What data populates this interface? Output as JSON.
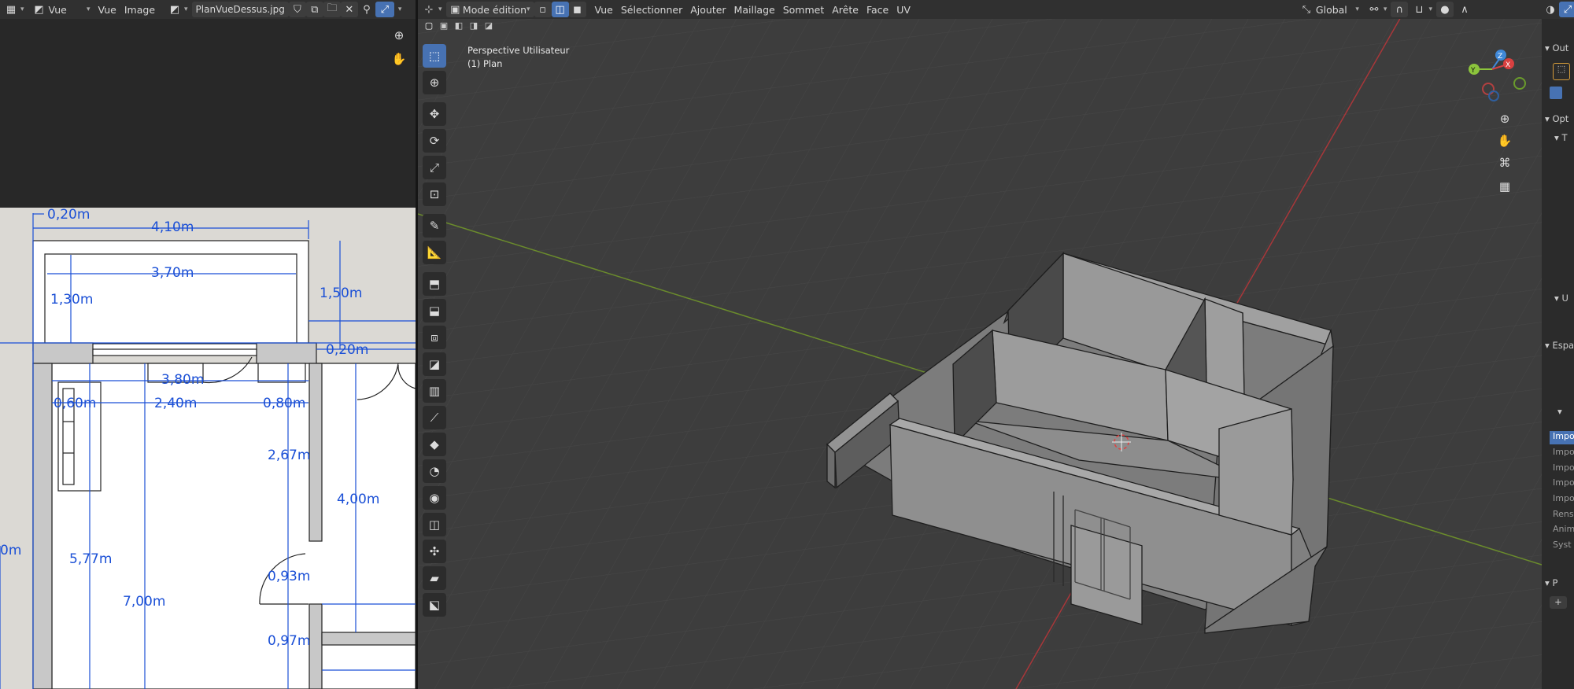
{
  "image_editor": {
    "header": {
      "view_menu": "Vue",
      "menus": [
        "Vue",
        "Image"
      ],
      "image_name": "PlanVueDessus.jpg"
    },
    "dimensions": [
      "0,20m",
      "4,10m",
      "3,70m",
      "1,30m",
      "1,50m",
      "0,20m",
      "3,80m",
      "0,60m",
      "2,40m",
      "0,80m",
      "2,67m",
      "4,00m",
      "5,77m",
      "7,00m",
      "0,93m",
      "0,97m",
      "0m"
    ]
  },
  "viewport": {
    "header": {
      "mode": "Mode édition",
      "menus": [
        "Vue",
        "Sélectionner",
        "Ajouter",
        "Maillage",
        "Sommet",
        "Arête",
        "Face",
        "UV"
      ],
      "transform_orientation": "Global"
    },
    "overlay_title": "Perspective Utilisateur",
    "overlay_object": "(1) Plan",
    "gizmo": {
      "x": "X",
      "y": "Y",
      "z": "Z"
    },
    "tools": [
      "select-box",
      "cursor",
      "move",
      "rotate",
      "scale",
      "transform",
      "annotate",
      "measure",
      "add-cube",
      "extrude",
      "inset",
      "bevel",
      "loop-cut",
      "knife",
      "poly-build",
      "spin",
      "smooth",
      "edge-slide",
      "shrink-fatten",
      "shear",
      "rip"
    ]
  },
  "right_panel": {
    "sections": [
      "Out",
      "Opt",
      "T",
      "U",
      "Espa"
    ],
    "items": [
      "Impo",
      "Impo",
      "Impo",
      "Impo",
      "Impo",
      "Rens",
      "Anim",
      "Syst"
    ],
    "bottom": "P"
  },
  "colors": {
    "accent": "#4772b3",
    "dimension_blue": "#1a4fd6",
    "x_axis": "#d94040",
    "y_axis": "#8cc43c",
    "z_axis": "#3f88d8"
  }
}
